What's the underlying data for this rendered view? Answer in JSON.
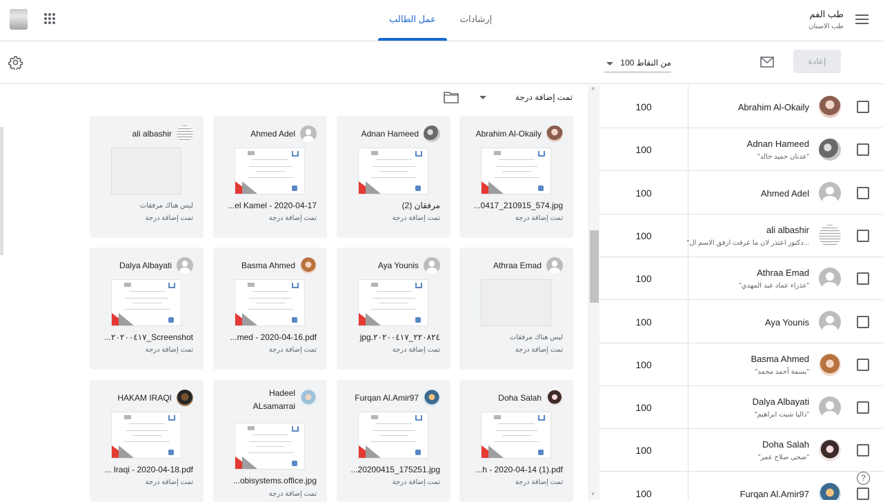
{
  "header": {
    "course_title": "طب الفم",
    "course_subtitle": "طب الاسنان",
    "tabs": [
      {
        "label": "عمل الطالب",
        "active": true
      },
      {
        "label": "إرشادات",
        "active": false
      }
    ],
    "accent_color": "#1967d2"
  },
  "toolbar": {
    "return_label": "إعادة",
    "points_label": "100 من النقاط",
    "filter_label": "تمت إضافة درجة"
  },
  "students": [
    {
      "name": "Abrahim Al-Okaily",
      "note": "",
      "grade": "100"
    },
    {
      "name": "Adnan Hameed",
      "note": "\"عدنان حميد خالد\"",
      "grade": "100"
    },
    {
      "name": "Ahmed Adel",
      "note": "",
      "grade": "100"
    },
    {
      "name": "ali albashir",
      "note": "\"دكتور اعتذر لان ما عرفت ارفق الاسم ال...",
      "grade": "100"
    },
    {
      "name": "Athraa Emad",
      "note": "\"عذراء عماد عبد المهدي\"",
      "grade": "100"
    },
    {
      "name": "Aya Younis",
      "note": "",
      "grade": "100"
    },
    {
      "name": "Basma Ahmed",
      "note": "\"بسمة أحمد محمد\"",
      "grade": "100"
    },
    {
      "name": "Dalya Albayati",
      "note": "\"داليا شيت ابراهيم\"",
      "grade": "100"
    },
    {
      "name": "Doha Salah",
      "note": "\"ضحى صلاح عمر\"",
      "grade": "100"
    },
    {
      "name": "Furqan Al.Amir97",
      "note": "",
      "grade": "100"
    }
  ],
  "cards": [
    {
      "name": "Abrahim Al-Okaily",
      "file": "...0417_210915_574.jpg",
      "status": "تمت إضافة درجة",
      "empty": false
    },
    {
      "name": "Adnan Hameed",
      "file": "مرفقان (2)",
      "status": "تمت إضافة درجة",
      "empty": false
    },
    {
      "name": "Ahmed Adel",
      "file": "...el Kamel - 2020-04-17",
      "status": "تمت إضافة درجة",
      "empty": false
    },
    {
      "name": "ali albashir",
      "file": "ليس هناك مرفقات",
      "status": "تمت إضافة درجة",
      "empty": true
    },
    {
      "name": "Athraa Emad",
      "file": "ليس هناك مرفقات",
      "status": "تمت إضافة درجة",
      "empty": true
    },
    {
      "name": "Aya Younis",
      "file": "jpg.٢٢٠٨٢٤_٢٠٢٠٠٤١٧",
      "status": "تمت إضافة درجة",
      "empty": false
    },
    {
      "name": "Basma Ahmed",
      "file": "...med - 2020-04-16.pdf",
      "status": "تمت إضافة درجة",
      "empty": false
    },
    {
      "name": "Dalya Albayati",
      "file": "...٢٠٢٠٠٤١٧_Screenshot",
      "status": "تمت إضافة درجة",
      "empty": false
    },
    {
      "name": "Doha Salah",
      "file": "...h - 2020-04-14 (1).pdf",
      "status": "تمت إضافة درجة",
      "empty": false
    },
    {
      "name": "Furqan Al.Amir97",
      "file": "...20200415_175251.jpg",
      "status": "تمت إضافة درجة",
      "empty": false
    },
    {
      "name": "Hadeel ALsamarrai",
      "file": "...obisystems.office.jpg",
      "status": "تمت إضافة درجة",
      "empty": false
    },
    {
      "name": "HAKAM IRAQI",
      "file": "... Iraqi - 2020-04-18.pdf",
      "status": "تمت إضافة درجة",
      "empty": false
    }
  ]
}
